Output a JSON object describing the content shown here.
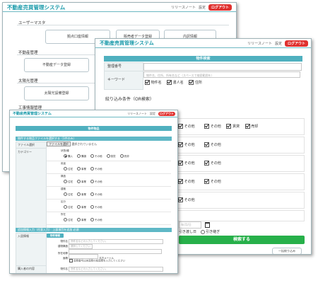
{
  "app_title": "不動産売買管理システム",
  "header": {
    "release_notes": "リリースノート",
    "settings": "設定",
    "logout": "ログアウト"
  },
  "win1": {
    "section_user": "ユーザーマスタ",
    "user_buttons": [
      "拠点口座情報",
      "販売者データ登録",
      "内訳情報"
    ],
    "section_property": "不動産管理",
    "property_button": "不動産データ登録",
    "section_solar": "太陽光管理",
    "solar_button": "太陽光設備登録",
    "section_construction": "工事情報管理"
  },
  "win2": {
    "section_title": "物件検索",
    "row_id_label": "整理番号",
    "row_keyword_label": "キーワード",
    "keyword_placeholder": "物件名、住所、所有名など（スペースで検索範囲を）",
    "keyword_checks": [
      "物件名",
      "書人名",
      "住所"
    ],
    "filter_title": "絞り込み条件（OR検索）",
    "filter_label": "その他",
    "filter_extra": [
      "賃貸",
      "売却"
    ],
    "date_placeholder": "年/月/日",
    "no_refresh": "引き継ぎ",
    "other_label": "引き渡し日",
    "search_button": "検索する",
    "cut_button": "一括絞り込み"
  },
  "win3": {
    "section_title": "物件物品",
    "block1_title": "物件する物品ファイルを選択する（1件のみ）",
    "file_label": "ファイル選択",
    "file_button": "ファイルを選択",
    "file_none": "選択されていません",
    "category_label": "カテゴリー",
    "groups": [
      {
        "name": "状態/種",
        "options": [
          "購入",
          "購損",
          "その他",
          "賃貸",
          "売却"
        ]
      },
      {
        "name": "用途",
        "options": [
          "住宅",
          "事業",
          "その他"
        ]
      },
      {
        "name": "構造",
        "options": [
          "住宅",
          "事業",
          "その他"
        ]
      },
      {
        "name": "建築",
        "options": [
          "住宅",
          "事業",
          "その他"
        ]
      },
      {
        "name": "区分",
        "options": [
          "住宅",
          "事業",
          "その他"
        ]
      },
      {
        "name": "所在",
        "options": [
          "住宅",
          "事業",
          "その他"
        ]
      }
    ],
    "block2_title": "追加情報入力（任意入力） 上部項目を追加 必須",
    "detail_label": "入居情報",
    "detail_btn": "物件情報",
    "fields": [
      {
        "label": "物件名",
        "placeholder": "物件名などの入力してください。"
      },
      {
        "label": "建物構造",
        "placeholder": "選択してください"
      },
      {
        "label": "所在地等",
        "placeholder": ""
      },
      {
        "label": "面積",
        "placeholder": "平方メートル"
      }
    ],
    "note": "面積番号は床面積の総面積を入力してください",
    "bottom_label": "購入者の内容",
    "bottom_field": "物件名"
  }
}
